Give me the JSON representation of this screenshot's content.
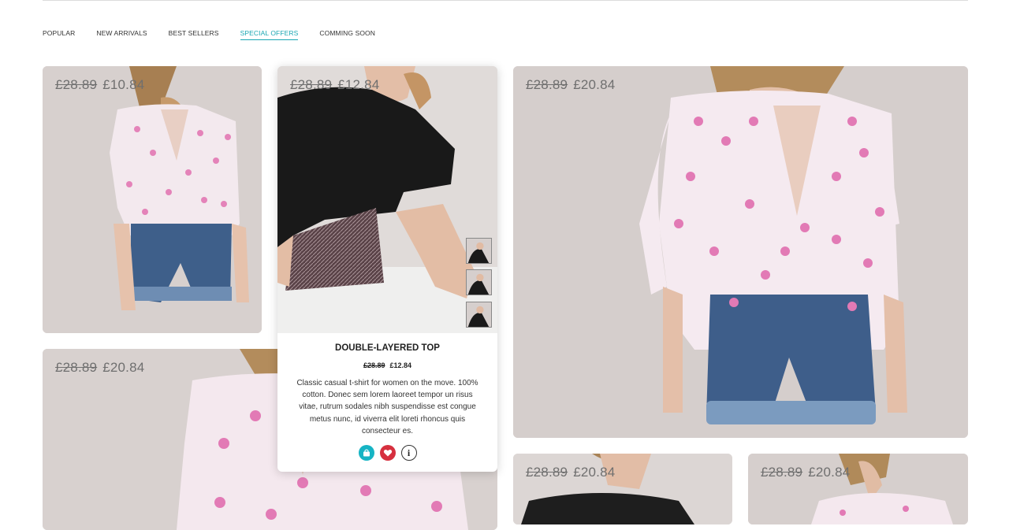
{
  "tabs": [
    {
      "label": "POPULAR",
      "active": false
    },
    {
      "label": "NEW ARRIVALS",
      "active": false
    },
    {
      "label": "BEST SELLERS",
      "active": false
    },
    {
      "label": "SPECIAL OFFERS",
      "active": true
    },
    {
      "label": "COMMING SOON",
      "active": false
    }
  ],
  "products": [
    {
      "old_price": "£28.89",
      "new_price": "£10.84"
    },
    {
      "old_price": "£28.89",
      "new_price": "£12.84"
    },
    {
      "old_price": "£28.89",
      "new_price": "£20.84"
    },
    {
      "old_price": "£28.89",
      "new_price": "£20.84"
    },
    {
      "old_price": "£28.89",
      "new_price": "£20.84"
    },
    {
      "old_price": "£28.89",
      "new_price": "£20.84"
    }
  ],
  "popup": {
    "title": "DOUBLE-LAYERED TOP",
    "old_price": "£28.89",
    "new_price": "£12.84",
    "description": "Classic casual t-shirt for women on the move. 100% cotton. Donec sem lorem laoreet tempor un risus vitae, rutrum sodales nibh suspendisse est congue metus nunc, id viverra elit loreti rhoncus quis consecteur es.",
    "info_label": "i"
  },
  "colors": {
    "accent": "#1aa7b3",
    "bag_button": "#16b4c4",
    "heart_button": "#d6303f",
    "price_text": "#6f6f6f"
  },
  "icons": [
    "shopping-bag-icon",
    "heart-icon",
    "info-icon"
  ]
}
